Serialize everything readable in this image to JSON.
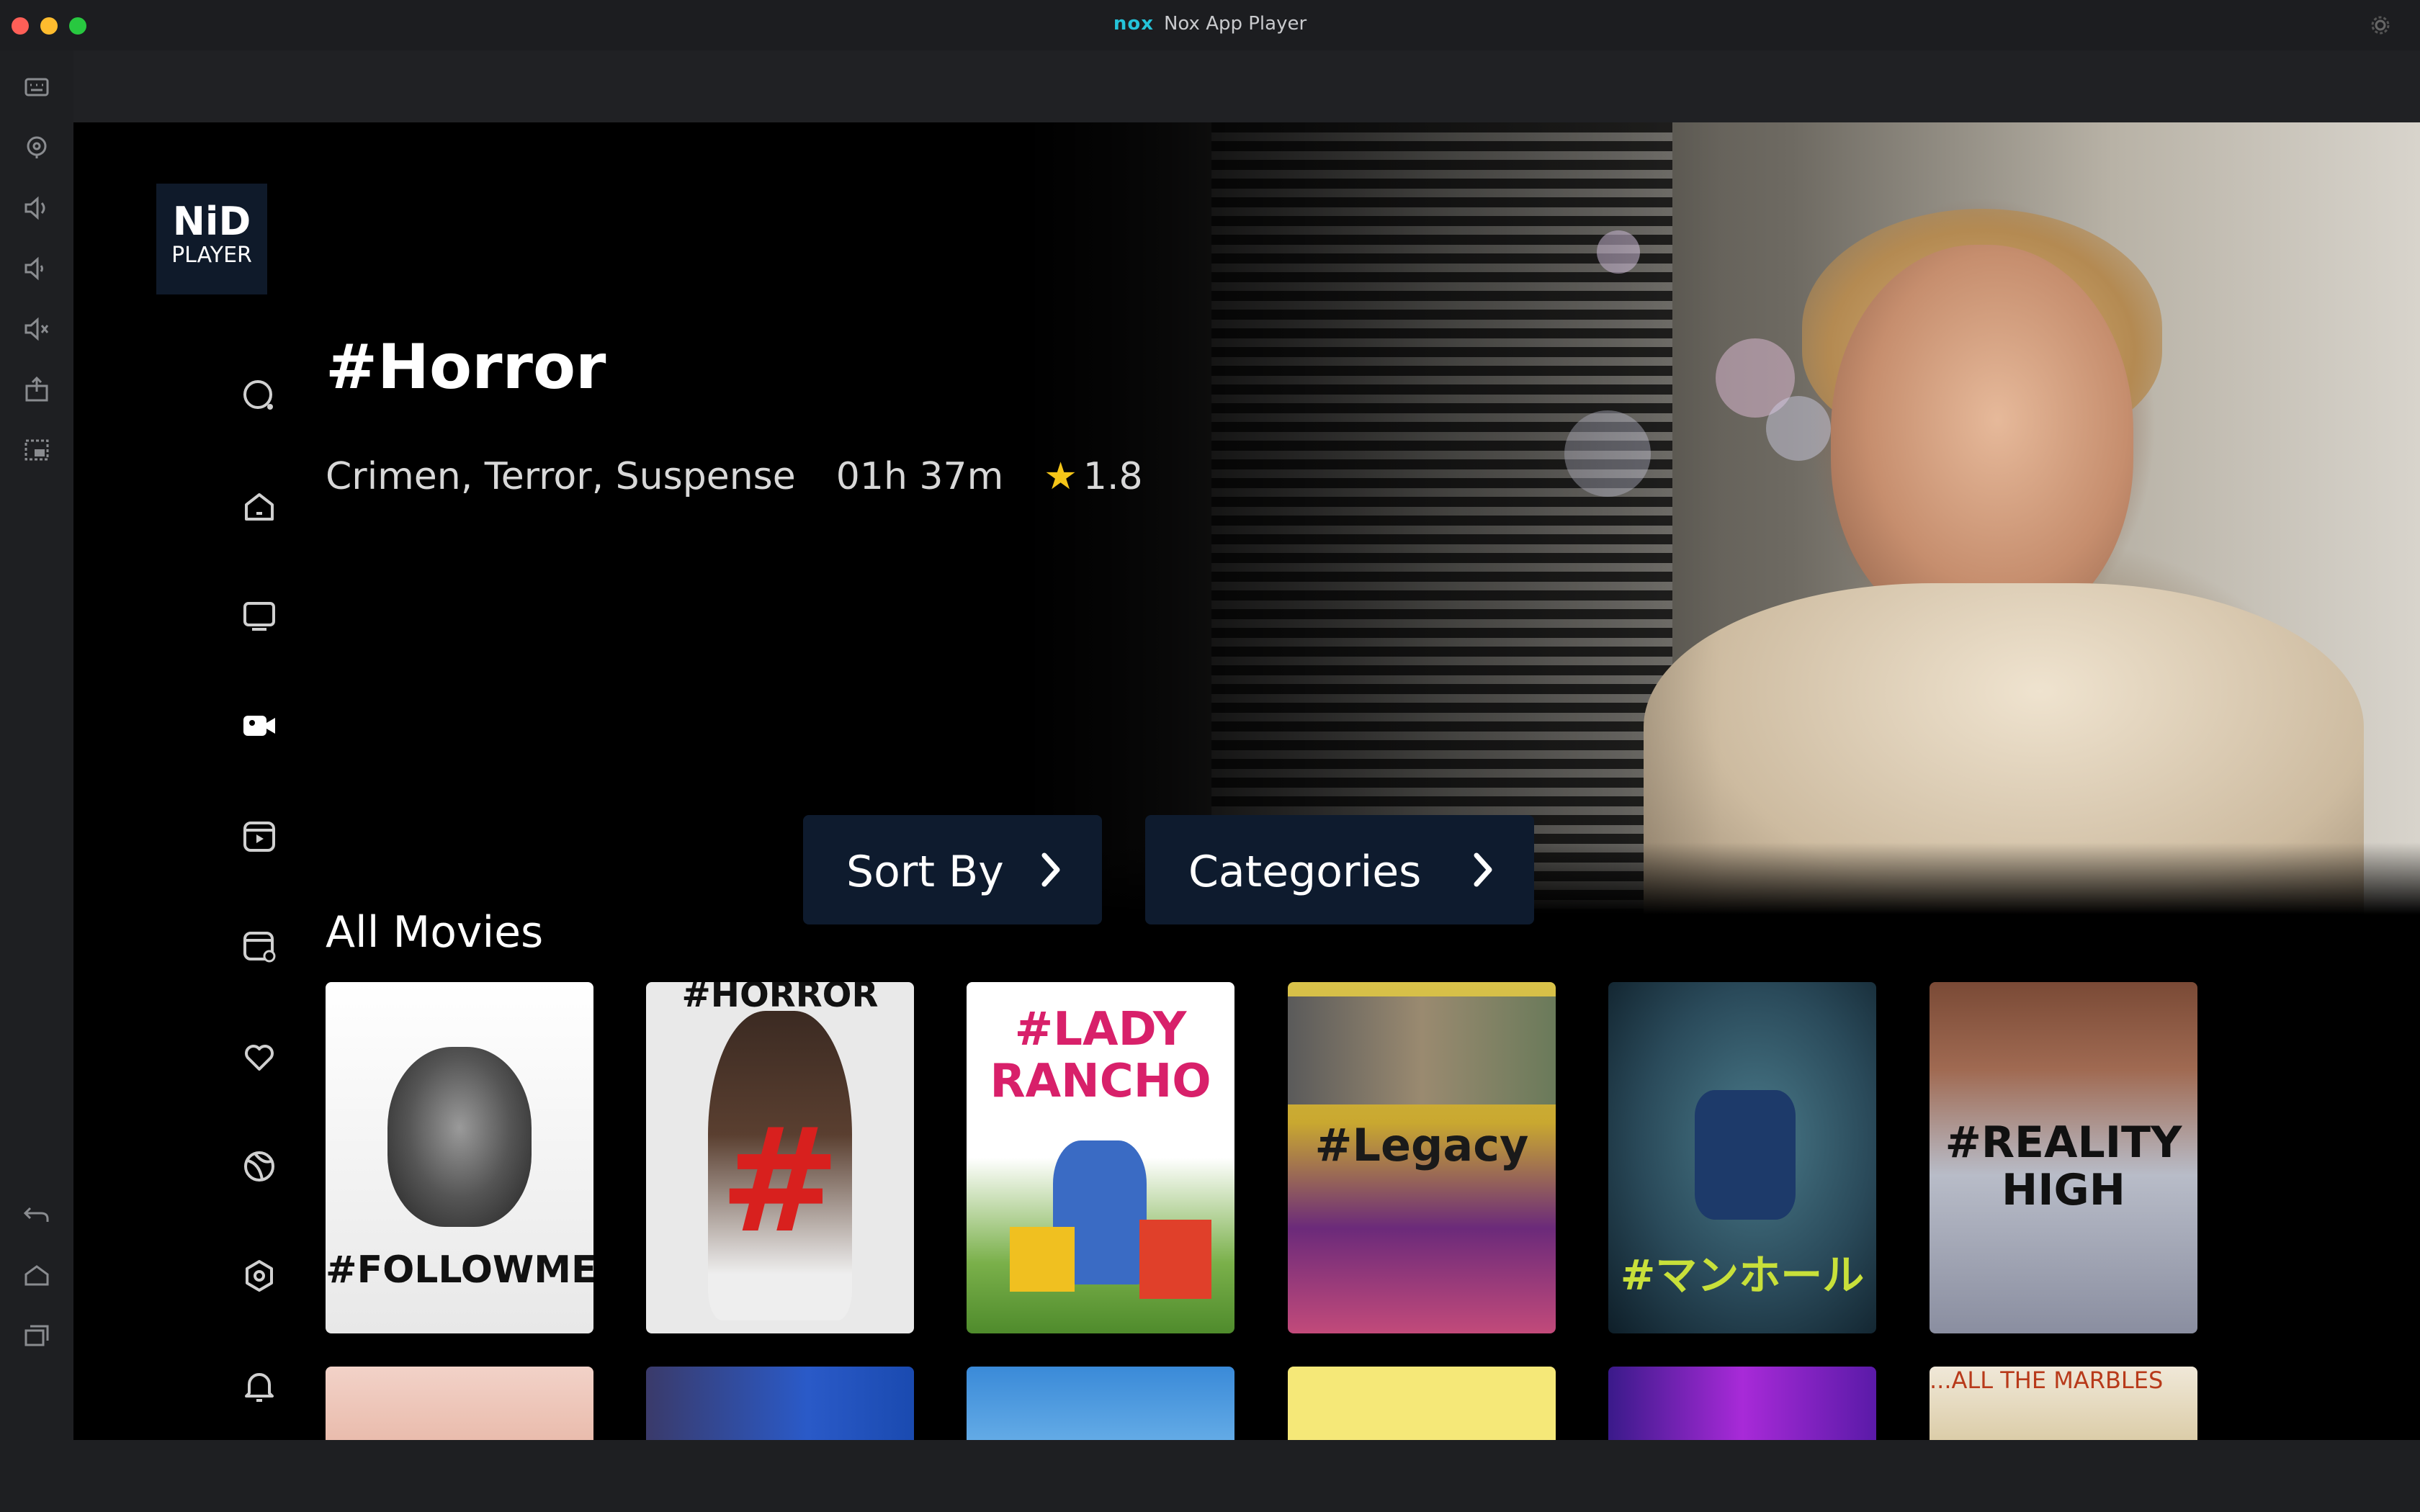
{
  "window": {
    "title": "Nox App Player",
    "logo_text": "nox"
  },
  "app": {
    "logo_line1": "NiD",
    "logo_line2": "PLAYER",
    "featured": {
      "title": "#Horror",
      "genres": "Crimen, Terror, Suspense",
      "duration": "01h 37m",
      "rating": "1.8"
    },
    "sort_by_label": "Sort By",
    "categories_label": "Categories",
    "section_title": "All Movies",
    "posters": [
      {
        "text": "#FOLLOWME"
      },
      {
        "text": "#HORROR"
      },
      {
        "text": "#LADY RANCHO"
      },
      {
        "text": "#Legacy"
      },
      {
        "text": "#マンホール"
      },
      {
        "text": "#REALITY HIGH"
      }
    ],
    "row2_posters": [
      {
        "text": ""
      },
      {
        "text": ""
      },
      {
        "text": ""
      },
      {
        "text": ""
      },
      {
        "text": ""
      },
      {
        "text": "...ALL THE MARBLES"
      }
    ]
  },
  "colors": {
    "accent_nox": "#25c3d9",
    "pill_bg": "#0e1b2e",
    "star": "#f5c518"
  }
}
